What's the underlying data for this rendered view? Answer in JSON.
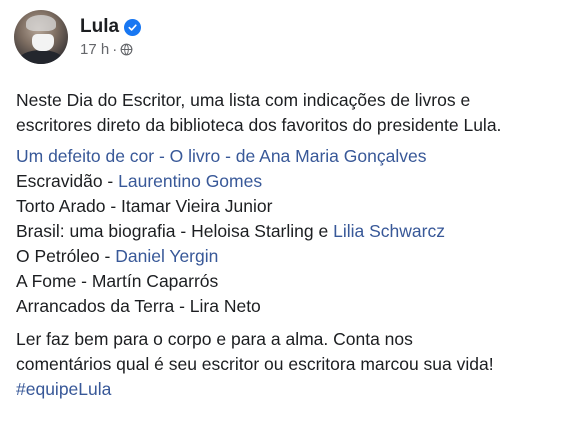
{
  "post": {
    "author": "Lula",
    "time": "17 h",
    "separator": "·",
    "intro_line1": "Neste Dia do Escritor, uma lista com indicações de livros e",
    "intro_line2": "escritores direto da biblioteca dos favoritos do presidente Lula.",
    "books": [
      {
        "text": "",
        "link": "Um defeito de cor - O livro - de Ana Maria Gonçalves",
        "mid": "",
        "link2": ""
      },
      {
        "text": "Escravidão - ",
        "link": "Laurentino Gomes",
        "mid": "",
        "link2": ""
      },
      {
        "text": "Torto Arado - Itamar Vieira Junior",
        "link": "",
        "mid": "",
        "link2": ""
      },
      {
        "text": "Brasil: uma biografia - Heloisa Starling e ",
        "link": "Lilia Schwarcz",
        "mid": "",
        "link2": ""
      },
      {
        "text": "O Petróleo - ",
        "link": "Daniel Yergin",
        "mid": "",
        "link2": ""
      },
      {
        "text": "A Fome - Martín Caparrós",
        "link": "",
        "mid": "",
        "link2": ""
      },
      {
        "text": "Arrancados da Terra - Lira Neto",
        "link": "",
        "mid": "",
        "link2": ""
      }
    ],
    "outro_line1": "Ler faz bem para o corpo e para a alma. Conta nos",
    "outro_line2": "comentários qual é seu escritor ou escritora marcou sua vida!",
    "hashtag": "#equipeLula"
  },
  "colors": {
    "text": "#1c1e21",
    "link": "#385898",
    "meta": "#65676b",
    "verified": "#1877f2"
  },
  "icons": [
    "verified-badge-icon",
    "globe-icon"
  ]
}
